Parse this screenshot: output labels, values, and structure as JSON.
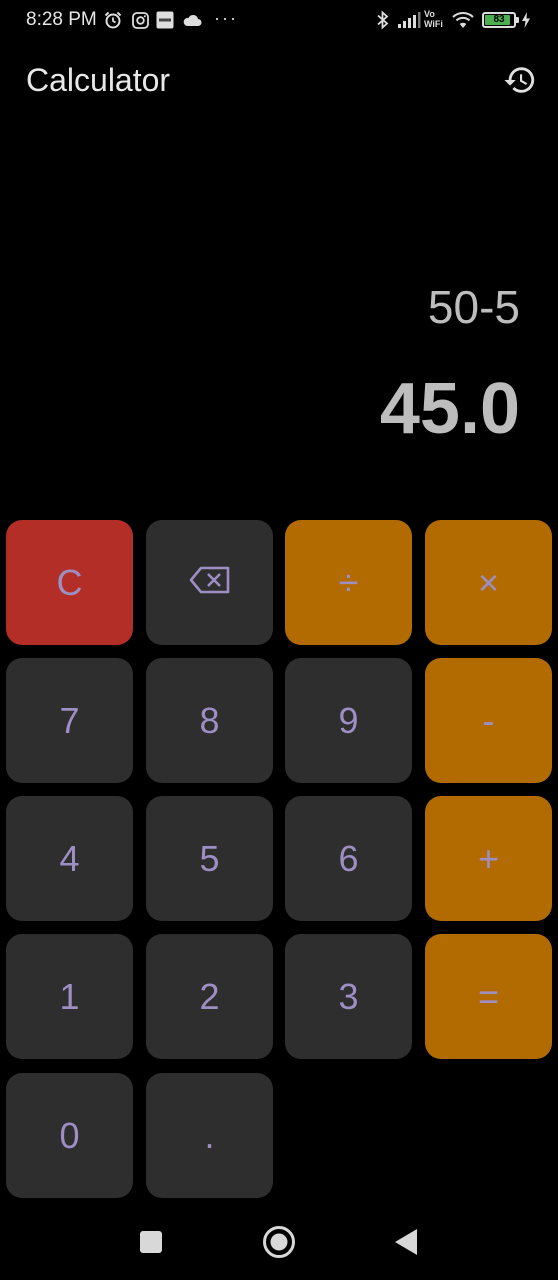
{
  "status_bar": {
    "time": "8:28 PM",
    "vowifi_line1": "Vo",
    "vowifi_line2": "WiFi",
    "battery_level": "83",
    "icons": [
      "alarm-icon",
      "instagram-icon",
      "tinnet-icon",
      "cloud-icon",
      "more-dots-icon",
      "bluetooth-icon",
      "signal-icon",
      "vowifi-icon",
      "wifi-icon",
      "battery-icon",
      "charging-icon"
    ],
    "more_dots": "···"
  },
  "app_bar": {
    "title": "Calculator",
    "history_icon": "history-icon"
  },
  "display": {
    "expression": "50-5",
    "result": "45.0"
  },
  "keypad": {
    "clear": "C",
    "backspace_icon": "backspace-icon",
    "divide": "÷",
    "multiply": "×",
    "seven": "7",
    "eight": "8",
    "nine": "9",
    "minus": "-",
    "four": "4",
    "five": "5",
    "six": "6",
    "plus": "+",
    "one": "1",
    "two": "2",
    "three": "3",
    "equals": "=",
    "zero": "0",
    "dot": "."
  },
  "colors": {
    "background": "#000000",
    "key": "#2e2e2e",
    "operator": "#b26b00",
    "clear": "#b22e26",
    "key_text": "#9d8ec4"
  },
  "nav_bar": {
    "icons": [
      "recents-square-icon",
      "home-circle-icon",
      "back-triangle-icon"
    ]
  }
}
